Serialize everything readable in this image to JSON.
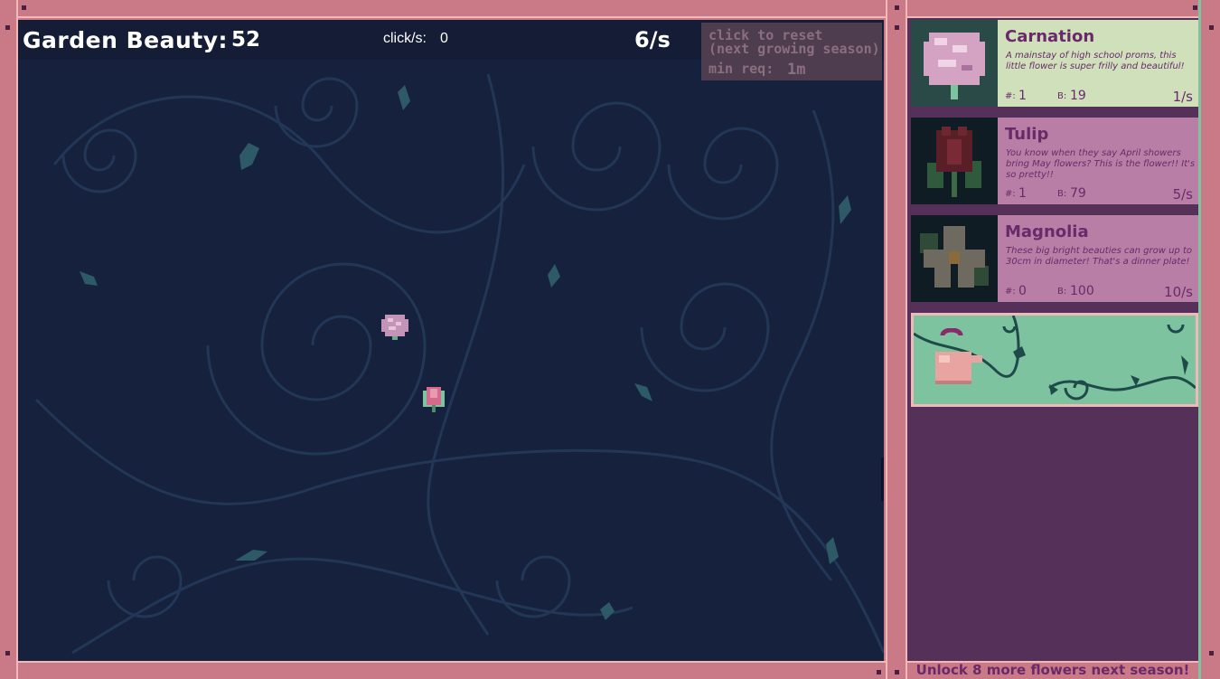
{
  "hud": {
    "beauty_label": "Garden Beauty:",
    "beauty_value": "52",
    "click_label": "click/s:",
    "click_value": "0",
    "rate": "6/s"
  },
  "reset": {
    "line1": "click to reset",
    "line2": "(next growing season)",
    "min_label": "min req:",
    "min_value": "1m"
  },
  "flowers": [
    {
      "name": "Carnation",
      "description": "A mainstay of high school proms, this little flower is super frilly and beautiful!",
      "count_label": "#:",
      "count": "1",
      "cost_label": "B:",
      "cost": "19",
      "rate": "1/s",
      "icon": "carnation-icon"
    },
    {
      "name": "Tulip",
      "description": "You know when they say April showers bring May flowers? This is the flower!! It's so pretty!!",
      "count_label": "#:",
      "count": "1",
      "cost_label": "B:",
      "cost": "79",
      "rate": "5/s",
      "icon": "tulip-icon"
    },
    {
      "name": "Magnolia",
      "description": "These big bright beauties can grow up to 30cm in diameter! That's a dinner plate!",
      "count_label": "#:",
      "count": "0",
      "cost_label": "B:",
      "cost": "100",
      "rate": "10/s",
      "icon": "magnolia-icon"
    }
  ],
  "upgrade": {
    "icon": "watering-can-icon"
  },
  "footer": {
    "unlock_text": "Unlock 8 more flowers next season!"
  },
  "colors": {
    "frame": "#c97a86",
    "garden_bg": "#16213e",
    "shop_bg": "#553058",
    "card_active": "#cfe0bb",
    "card_locked": "#b87ea6",
    "text_purple": "#6a2a6a",
    "mint": "#7ec3a0"
  }
}
